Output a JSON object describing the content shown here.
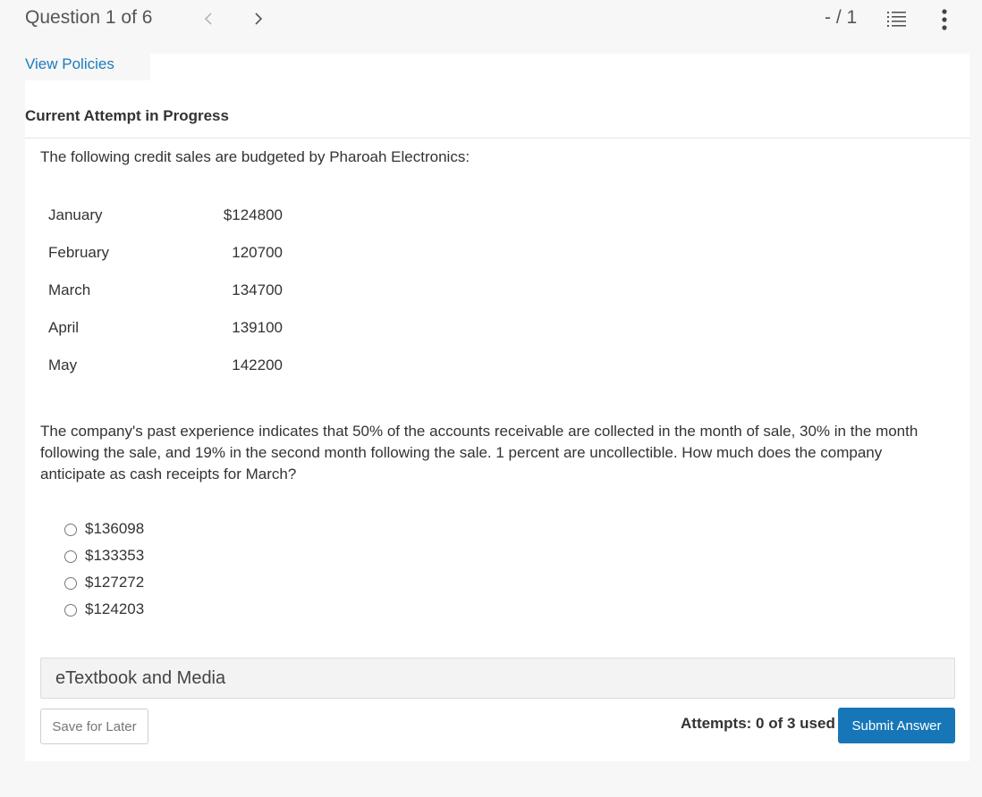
{
  "header": {
    "question_label": "Question 1 of 6",
    "score": "- / 1",
    "icons": [
      "chevron-left-icon",
      "chevron-right-icon",
      "list-icon",
      "more-vertical-icon"
    ]
  },
  "links": {
    "view_policies": "View Policies"
  },
  "attempt": {
    "title": "Current Attempt in Progress"
  },
  "question": {
    "intro": "The following credit sales are budgeted by Pharoah Electronics:",
    "sales": [
      {
        "month": "January",
        "amount": "$124800"
      },
      {
        "month": "February",
        "amount": "120700"
      },
      {
        "month": "March",
        "amount": "134700"
      },
      {
        "month": "April",
        "amount": "139100"
      },
      {
        "month": "May",
        "amount": "142200"
      }
    ],
    "problem": "The company's past experience indicates that 50% of the accounts receivable are collected in the month of sale, 30% in the month following the sale, and 19% in the second month following the sale. 1 percent are uncollectible. How much does the company anticipate as cash receipts for March?",
    "options": [
      "$136098",
      "$133353",
      "$127272",
      "$124203"
    ]
  },
  "footer": {
    "etextbook": "eTextbook and Media",
    "save_label": "Save for Later",
    "attempts": "Attempts: 0 of 3 used",
    "submit_label": "Submit Answer"
  },
  "colors": {
    "accent": "#1676b8",
    "link": "#1a7bbf"
  }
}
